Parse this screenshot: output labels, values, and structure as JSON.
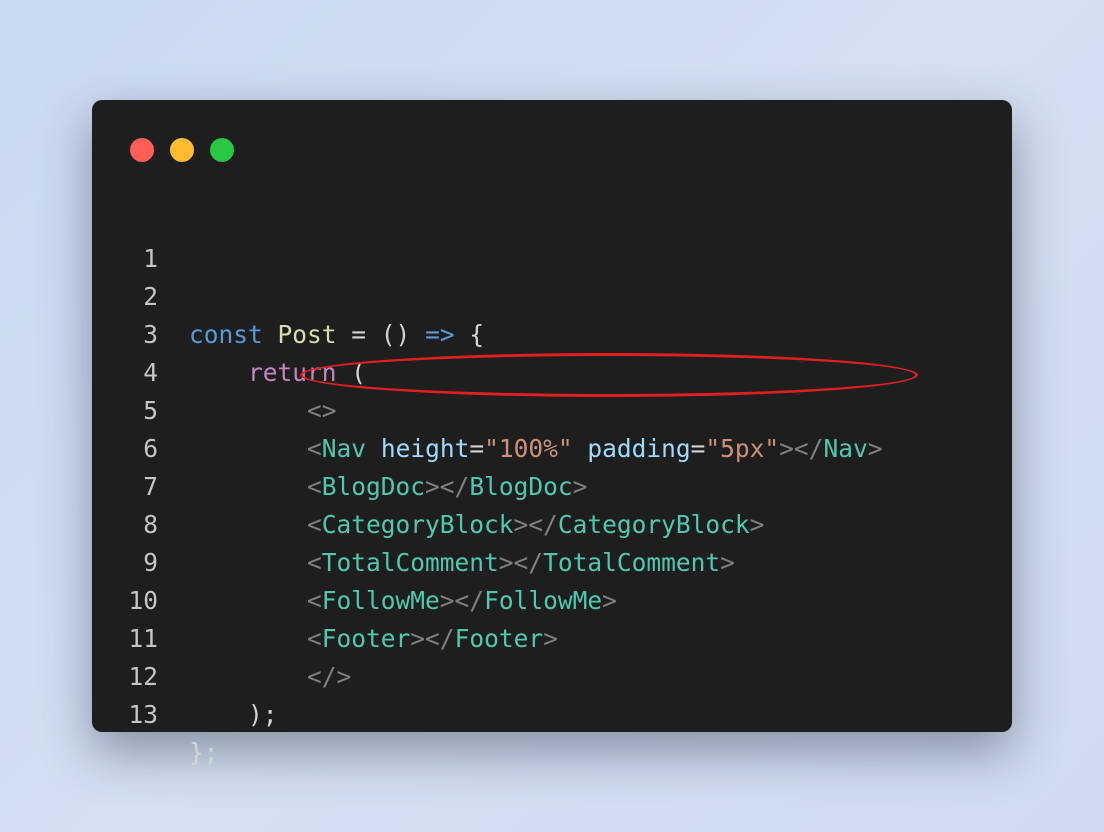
{
  "window": {
    "traffic_lights": [
      {
        "name": "close",
        "color": "#ff5f57"
      },
      {
        "name": "minimize",
        "color": "#febc2e"
      },
      {
        "name": "maximize",
        "color": "#28c840"
      }
    ]
  },
  "highlight": {
    "line": 5,
    "color": "#e02020"
  },
  "code": {
    "line_numbers": [
      "1",
      "2",
      "3",
      "4",
      "5",
      "6",
      "7",
      "8",
      "9",
      "10",
      "11",
      "12",
      "13"
    ],
    "l2": {
      "kw": "const",
      "name": "Post",
      "eq": " = () ",
      "arrow": "=>",
      "brace": " {"
    },
    "l3": {
      "kw": "return",
      "paren": " ("
    },
    "l4": {
      "frag": "<>"
    },
    "l5": {
      "open": "<",
      "tag": "Nav",
      "attr1": "height",
      "eq1": "=",
      "val1": "\"100%\"",
      "attr2": "padding",
      "eq2": "=",
      "val2": "\"5px\"",
      "close1": "></",
      "tag2": "Nav",
      "close2": ">"
    },
    "l6": {
      "tag": "BlogDoc"
    },
    "l7": {
      "tag": "CategoryBlock"
    },
    "l8": {
      "tag": "TotalComment"
    },
    "l9": {
      "tag": "FollowMe"
    },
    "l10": {
      "tag": "Footer"
    },
    "l11": {
      "frag": "</>"
    },
    "l12": {
      "text": ");"
    },
    "l13": {
      "text": "};"
    },
    "lt": "<",
    "gt": ">",
    "lt_slash": "></"
  }
}
